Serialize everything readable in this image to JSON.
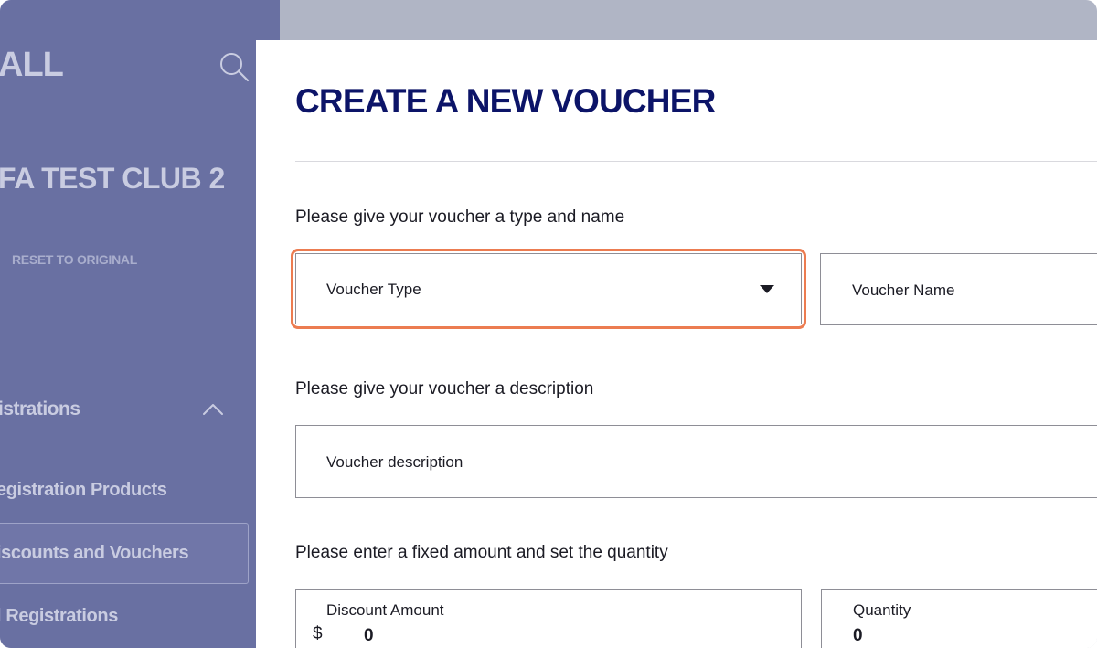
{
  "sidebar": {
    "brand": "ALL",
    "club_name": "FA TEST CLUB 2",
    "reset_label": "RESET TO ORIGINAL",
    "section_title": "istrations",
    "nav_items": [
      {
        "label": "egistration Products"
      },
      {
        "label": "iscounts and Vouchers"
      },
      {
        "label": "l Registrations"
      }
    ]
  },
  "main": {
    "title": "CREATE A NEW VOUCHER",
    "type_name_prompt": "Please give your voucher a type and name",
    "voucher_type": {
      "label": "Voucher Type"
    },
    "voucher_name": {
      "label": "Voucher Name"
    },
    "description_prompt": "Please give your voucher a description",
    "voucher_description": {
      "label": "Voucher description"
    },
    "amount_prompt": "Please enter a fixed amount and set the quantity",
    "discount_amount": {
      "label": "Discount Amount",
      "currency": "$",
      "value": "0"
    },
    "quantity": {
      "label": "Quantity",
      "value": "0"
    }
  },
  "colors": {
    "sidebar_bg": "#6970a2",
    "title": "#0c1468",
    "highlight": "#ec7c51"
  },
  "icons": {
    "search": "search-icon",
    "chevron": "chevron-up-icon",
    "caret": "caret-down-icon"
  }
}
